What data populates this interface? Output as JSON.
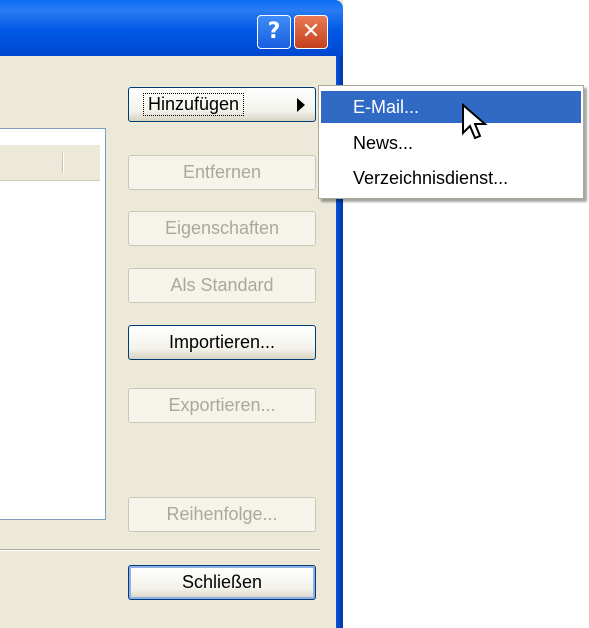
{
  "title_bar": {
    "help_glyph": "?",
    "close_glyph": "✕"
  },
  "buttons": {
    "add": "Hinzufügen",
    "remove": "Entfernen",
    "properties": "Eigenschaften",
    "set_default": "Als Standard",
    "import": "Importieren...",
    "export": "Exportieren...",
    "order": "Reihenfolge...",
    "close": "Schließen"
  },
  "add_menu": {
    "items": [
      {
        "label": "E-Mail..."
      },
      {
        "label": "News..."
      },
      {
        "label": "Verzeichnisdienst..."
      }
    ],
    "selected_index": 0
  },
  "colors": {
    "titlebar_blue": "#0058e6",
    "menu_highlight": "#316ac5",
    "dialog_face": "#ece9d8",
    "disabled_text": "#aca899"
  }
}
